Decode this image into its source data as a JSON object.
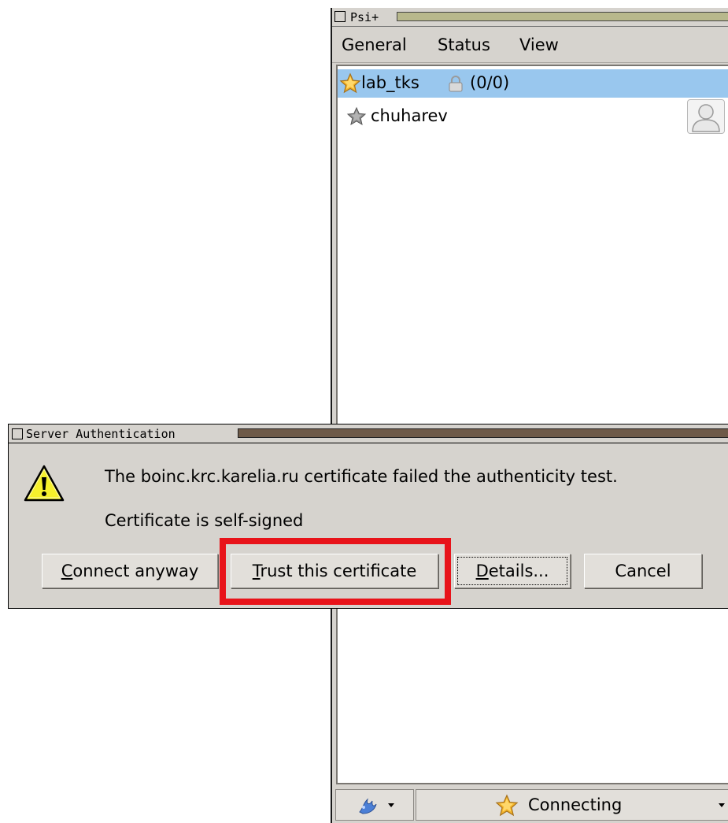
{
  "psi_window": {
    "title": "Psi+",
    "menu": [
      "General",
      "Status",
      "View"
    ],
    "roster": {
      "group": {
        "name": "lab_tks",
        "count": "(0/0)",
        "icon": "star-icon",
        "lock_icon": "lock-icon"
      },
      "contacts": [
        {
          "name": "chuharev",
          "icon": "offline-star-icon",
          "avatar": "avatar-placeholder-icon"
        }
      ],
      "selected_color": "#99c7ee"
    },
    "bottom_bar": {
      "menu_icon": "psi-logo-icon",
      "status_icon": "star-icon",
      "status_text": "Connecting"
    }
  },
  "dialog": {
    "title": "Server Authentication",
    "icon": "warning-icon",
    "message": "The boinc.krc.karelia.ru certificate failed the authenticity test.",
    "detail": "Certificate is self-signed",
    "buttons": {
      "connect_anyway": {
        "mnemonic": "C",
        "rest": "onnect anyway"
      },
      "trust_certificate": {
        "mnemonic": "T",
        "rest": "rust this certificate"
      },
      "details": {
        "mnemonic": "D",
        "rest": "etails..."
      },
      "cancel": {
        "label": "Cancel"
      }
    },
    "title_bar_color": "#6e5a48"
  },
  "annotation": {
    "highlight_color": "#e8131a",
    "target": "trust_certificate"
  }
}
